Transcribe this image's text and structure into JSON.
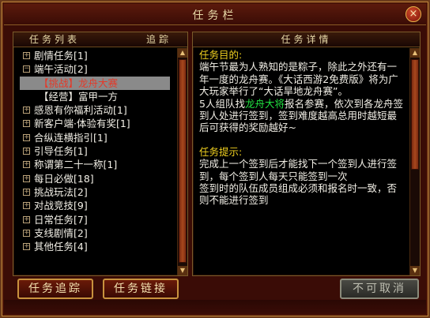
{
  "window": {
    "title": "任务栏",
    "close": "×"
  },
  "left_panel": {
    "header_left": "任务列表",
    "header_right": "追踪",
    "items": [
      {
        "label": "剧情任务[1]",
        "expander": "⊕",
        "type": "group"
      },
      {
        "label": "端午活动[2]",
        "expander": "⊖",
        "type": "group"
      },
      {
        "label": "【挑战】龙舟大赛",
        "type": "sub",
        "selected": true
      },
      {
        "label": "【经营】富甲一方",
        "type": "sub"
      },
      {
        "label": "感恩有你福利活动[1]",
        "expander": "⊕",
        "type": "group"
      },
      {
        "label": "新客户端·体验有奖[1]",
        "expander": "⊕",
        "type": "group"
      },
      {
        "label": "合纵连横指引[1]",
        "expander": "⊕",
        "type": "group"
      },
      {
        "label": "引导任务[1]",
        "expander": "⊕",
        "type": "group"
      },
      {
        "label": "称谓第二十一称[1]",
        "expander": "⊕",
        "type": "group"
      },
      {
        "label": "每日必做[18]",
        "expander": "⊕",
        "type": "group"
      },
      {
        "label": "挑战玩法[2]",
        "expander": "⊕",
        "type": "group"
      },
      {
        "label": "对战竞技[9]",
        "expander": "⊕",
        "type": "group"
      },
      {
        "label": "日常任务[7]",
        "expander": "⊕",
        "type": "group"
      },
      {
        "label": "支线剧情[2]",
        "expander": "⊕",
        "type": "group"
      },
      {
        "label": "其他任务[4]",
        "expander": "⊕",
        "type": "group"
      }
    ]
  },
  "right_panel": {
    "header": "任务详情",
    "goal_head": "任务目的:",
    "goal_text": "端午节最为人熟知的是粽子，除此之外还有一年一度的龙舟赛。《大话西游2免费版》将为广大玩家举行了“大话旱地龙舟赛”。",
    "goal_text2_pre": "5人组队找",
    "goal_npc": "龙舟大将",
    "goal_text2_post": "报名参赛，依次到各龙舟签到人处进行签到，签到难度越高总用时越短最后可获得的奖励越好~",
    "hint_head": "任务提示:",
    "hint_text": "完成上一个签到后才能找下一个签到人进行签到，每个签到人每天只能签到一次",
    "hint_text2": "签到时的队伍成员组成必须和报名时一致，否则不能进行签到"
  },
  "buttons": {
    "track": "任务追踪",
    "link": "任务链接",
    "cancel": "不可取消"
  },
  "colors": {
    "frame": "#3a0c06",
    "gold": "#c8923e",
    "heading": "#f0d020",
    "npc": "#20e040",
    "selected_text": "#e33a2a"
  }
}
